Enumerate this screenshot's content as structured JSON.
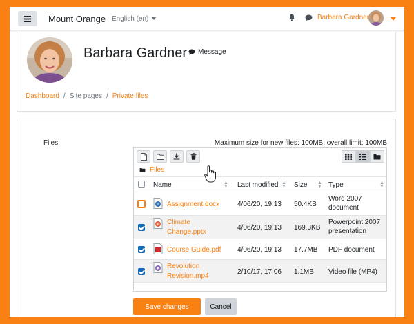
{
  "navbar": {
    "site_name": "Mount Orange",
    "language": "English (en)",
    "user_name": "Barbara Gardner",
    "icons": [
      "menu-icon",
      "bell-icon",
      "chat-icon",
      "caret-down-icon"
    ]
  },
  "profile": {
    "name": "Barbara Gardner",
    "message_label": "Message"
  },
  "breadcrumb": {
    "items": [
      "Dashboard",
      "Site pages",
      "Private files"
    ],
    "separator": "/"
  },
  "files_section": {
    "label": "Files",
    "max_size_text": "Maximum size for new files: 100MB, overall limit: 100MB",
    "path_label": "Files",
    "toolbar_icons": [
      "new-file-icon",
      "new-folder-icon",
      "download-icon",
      "delete-icon"
    ],
    "view_icons": [
      "grid-view-icon",
      "list-view-icon",
      "tree-view-icon"
    ],
    "columns": [
      "Name",
      "Last modified",
      "Size",
      "Type"
    ],
    "rows": [
      {
        "name": "Assignment.docx",
        "modified": "4/06/20, 19:13",
        "size": "50.4KB",
        "type_line1": "Word 2007",
        "type_line2": "document",
        "checked": false,
        "icon": "word-document-icon"
      },
      {
        "name_line1": "Climate",
        "name_line2": "Change.pptx",
        "modified": "4/06/20, 19:13",
        "size": "169.3KB",
        "type_line1": "Powerpoint 2007",
        "type_line2": "presentation",
        "checked": true,
        "icon": "powerpoint-icon"
      },
      {
        "name": "Course Guide.pdf",
        "modified": "4/06/20, 19:13",
        "size": "17.7MB",
        "type": "PDF document",
        "checked": true,
        "icon": "pdf-icon"
      },
      {
        "name_line1": "Revolution",
        "name_line2": "Revision.mp4",
        "modified": "2/10/17, 17:06",
        "size": "1.1MB",
        "type": "Video file (MP4)",
        "checked": true,
        "icon": "video-icon"
      }
    ]
  },
  "actions": {
    "save_label": "Save changes",
    "cancel_label": "Cancel"
  },
  "colors": {
    "brand": "#f98012",
    "checkbox": "#0f6cbf",
    "button_secondary": "#ced4da"
  }
}
